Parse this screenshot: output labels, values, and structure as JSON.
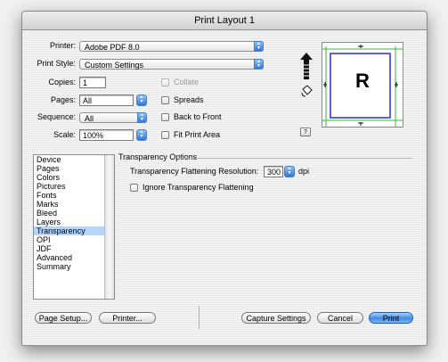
{
  "window": {
    "title": "Print Layout 1"
  },
  "printer": {
    "label": "Printer:",
    "value": "Adobe PDF 8.0"
  },
  "print_style": {
    "label": "Print Style:",
    "value": "Custom Settings"
  },
  "copies": {
    "label": "Copies:",
    "value": "1"
  },
  "pages": {
    "label": "Pages:",
    "value": "All"
  },
  "sequence": {
    "label": "Sequence:",
    "value": "All"
  },
  "scale": {
    "label": "Scale:",
    "value": "100%"
  },
  "checkboxes": {
    "collate": "Collate",
    "spreads": "Spreads",
    "back_to_front": "Back to Front",
    "fit_print_area": "Fit Print Area"
  },
  "preview": {
    "letter": "R",
    "help": "?"
  },
  "categories": {
    "items": [
      "Device",
      "Pages",
      "Colors",
      "Pictures",
      "Fonts",
      "Marks",
      "Bleed",
      "Layers",
      "Transparency",
      "OPI",
      "JDF",
      "Advanced",
      "Summary"
    ],
    "selected": "Transparency"
  },
  "transparency": {
    "section_title": "Transparency Options",
    "resolution_label": "Transparency Flattening Resolution:",
    "resolution_value": "300",
    "resolution_unit": "dpi",
    "ignore_label": "Ignore Transparency Flattening"
  },
  "buttons": {
    "page_setup": "Page Setup...",
    "printer": "Printer...",
    "capture_settings": "Capture Settings",
    "cancel": "Cancel",
    "print": "Print"
  },
  "colors": {
    "accent": "#3e8ae6",
    "selection": "#b5d5fb",
    "guide_green": "#2dbd3a",
    "guide_blue": "#3a3ad8"
  }
}
